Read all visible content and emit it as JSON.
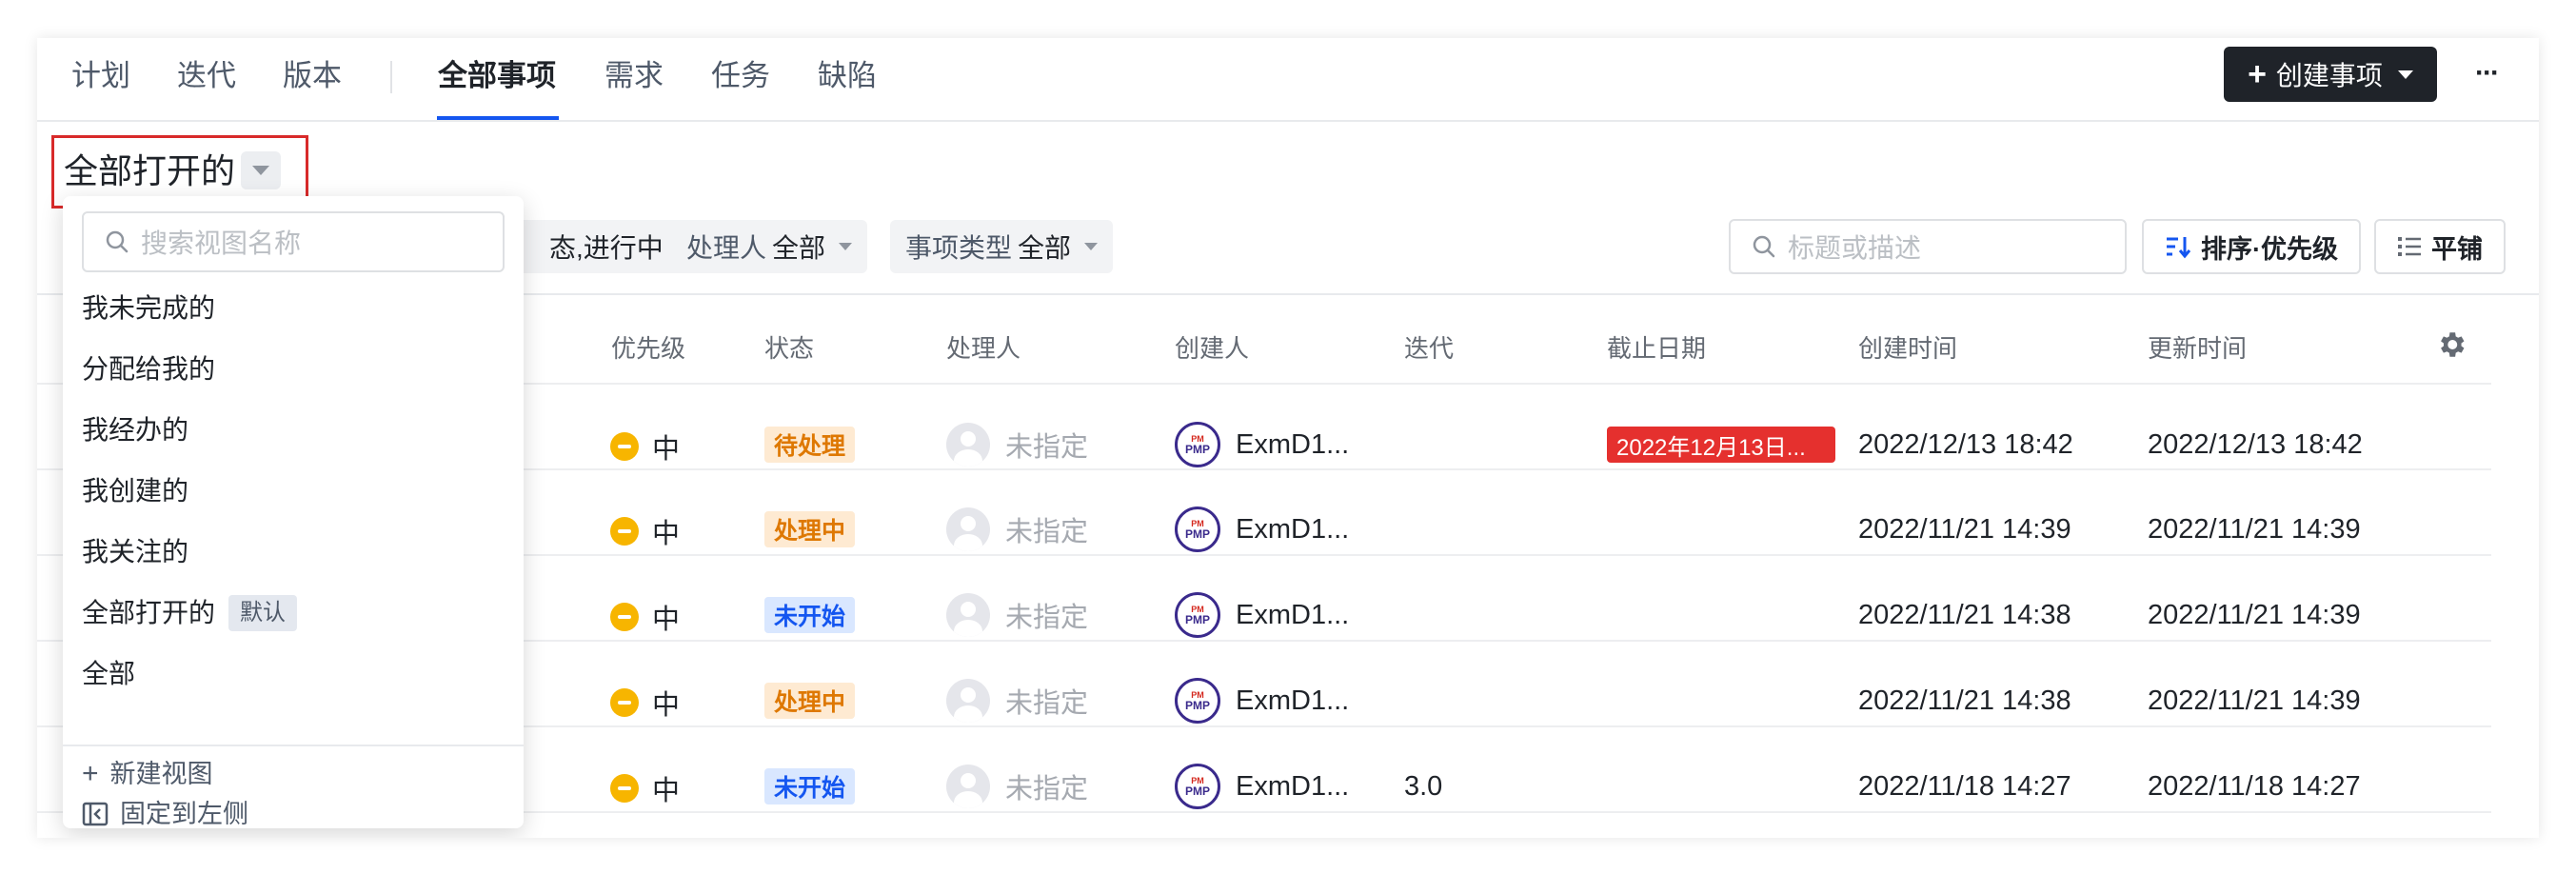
{
  "nav": {
    "tabs": [
      {
        "label": "计划"
      },
      {
        "label": "迭代"
      },
      {
        "label": "版本"
      },
      {
        "label": "全部事项"
      },
      {
        "label": "需求"
      },
      {
        "label": "任务"
      },
      {
        "label": "缺陷"
      }
    ],
    "active_tab": "全部事项",
    "create_label": "创建事项",
    "more_label": "···"
  },
  "view": {
    "title": "全部打开的"
  },
  "filters": {
    "status_partial": "态,进行中",
    "assignee_label": "处理人",
    "assignee_value": "全部",
    "type_label": "事项类型",
    "type_value": "全部",
    "search_placeholder": "标题或描述",
    "sort_label": "排序·优先级",
    "tile_label": "平铺"
  },
  "table": {
    "columns": [
      "优先级",
      "状态",
      "处理人",
      "创建人",
      "迭代",
      "截止日期",
      "创建时间",
      "更新时间"
    ],
    "rows": [
      {
        "priority": "中",
        "status": "待处理",
        "assignee": "未指定",
        "creator": "ExmD1...",
        "iteration": "",
        "due": "2022年12月13日...",
        "created": "2022/12/13 18:42",
        "updated": "2022/12/13 18:42"
      },
      {
        "priority": "中",
        "status": "处理中",
        "assignee": "未指定",
        "creator": "ExmD1...",
        "iteration": "",
        "due": "",
        "created": "2022/11/21 14:39",
        "updated": "2022/11/21 14:39"
      },
      {
        "priority": "中",
        "status": "未开始",
        "assignee": "未指定",
        "creator": "ExmD1...",
        "iteration": "",
        "due": "",
        "created": "2022/11/21 14:38",
        "updated": "2022/11/21 14:39"
      },
      {
        "priority": "中",
        "status": "处理中",
        "assignee": "未指定",
        "creator": "ExmD1...",
        "iteration": "",
        "due": "",
        "created": "2022/11/21 14:38",
        "updated": "2022/11/21 14:39"
      },
      {
        "priority": "中",
        "status": "未开始",
        "assignee": "未指定",
        "creator": "ExmD1...",
        "iteration": "3.0",
        "due": "",
        "created": "2022/11/18 14:27",
        "updated": "2022/11/18 14:27"
      }
    ],
    "avatar_text_top": "PM",
    "avatar_text_bottom": "PMP"
  },
  "dropdown": {
    "search_placeholder": "搜索视图名称",
    "items": [
      {
        "label": "我未完成的"
      },
      {
        "label": "分配给我的"
      },
      {
        "label": "我经办的"
      },
      {
        "label": "我创建的"
      },
      {
        "label": "我关注的"
      },
      {
        "label": "全部打开的",
        "badge": "默认"
      },
      {
        "label": "全部"
      }
    ],
    "new_view_label": "新建视图",
    "pin_left_label": "固定到左侧"
  },
  "colors": {
    "accent": "#1456f0",
    "primary_button": "#1f2329",
    "due_overdue": "#e5302e",
    "priority_medium": "#f7b500",
    "highlight_box": "#d82a2a"
  }
}
